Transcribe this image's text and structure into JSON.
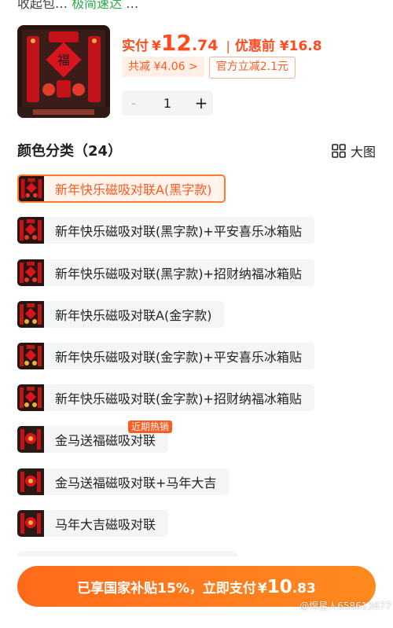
{
  "top_strip": {
    "text_a": "收起包…",
    "text_b": "极简速达",
    "text_c": "…"
  },
  "price": {
    "pay_label": "实付",
    "currency": "¥",
    "integer": "12",
    "decimal": ".74",
    "separator": "|",
    "original_label": "优惠前 ¥16.8"
  },
  "tags": {
    "total_discount": "共减 ¥4.06 >",
    "official": "官方立减2.1元"
  },
  "quantity": {
    "minus": "-",
    "value": "1",
    "plus": "+"
  },
  "section": {
    "title": "颜色分类（24）",
    "big_image_label": "大图",
    "big_image_icon": "grid-icon"
  },
  "options": [
    {
      "label": "新年快乐磁吸对联A(黑字款)"
    },
    {
      "label": "新年快乐磁吸对联(黑字款)+平安喜乐冰箱贴"
    },
    {
      "label": "新年快乐磁吸对联(黑字款)+招财纳福冰箱贴"
    },
    {
      "label": "新年快乐磁吸对联A(金字款)"
    },
    {
      "label": "新年快乐磁吸对联(金字款)+平安喜乐冰箱贴"
    },
    {
      "label": "新年快乐磁吸对联(金字款)+招财纳福冰箱贴"
    },
    {
      "label": "金马送福磁吸对联",
      "badge": "近期热销"
    },
    {
      "label": "金马送福磁吸对联+马年大吉"
    },
    {
      "label": "马年大吉磁吸对联"
    }
  ],
  "selected_option_index": 0,
  "cta": {
    "text": "已享国家补贴15%，立即支付",
    "currency": "¥",
    "integer": "10",
    "decimal": ".83"
  },
  "watermark": "@悍星人658613677",
  "colors": {
    "accent": "#ff5a1f",
    "cta_start": "#ff6a1a",
    "cta_end": "#ff8a1f",
    "option_bg": "#f4f5f7",
    "selected_border": "#ff7a2e"
  }
}
